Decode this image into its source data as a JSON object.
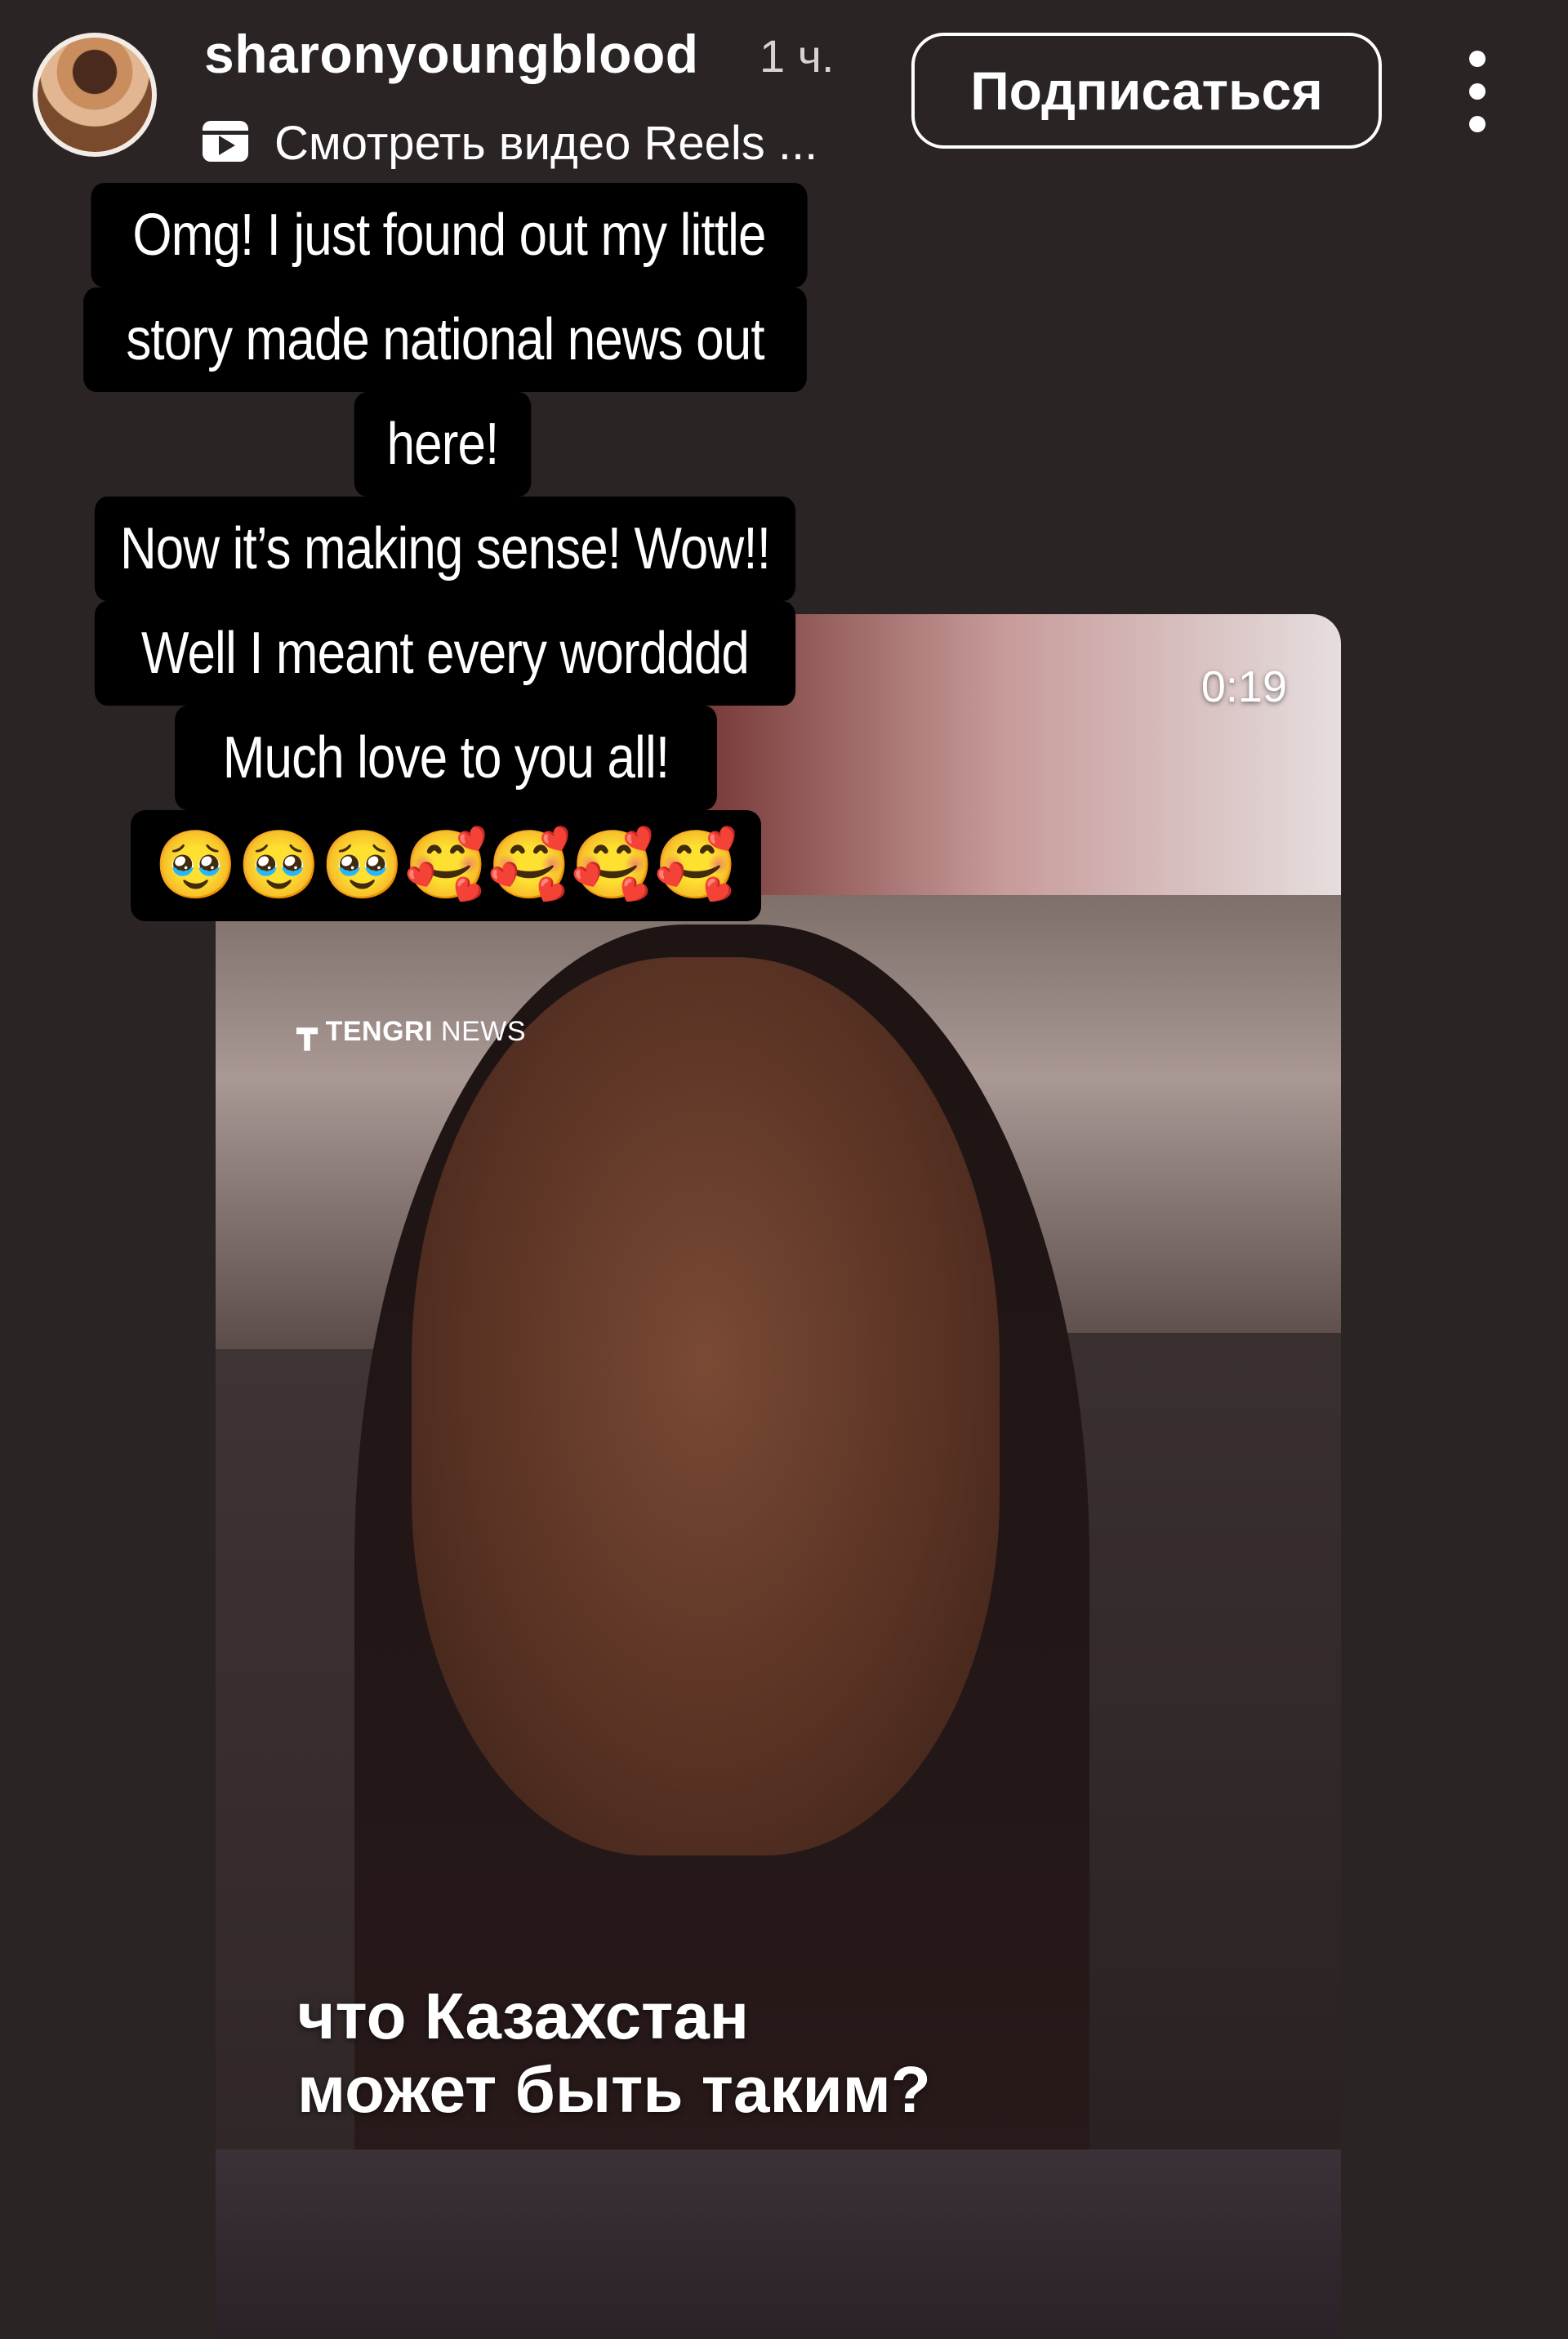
{
  "header": {
    "username": "sharonyoungblood",
    "time_ago": "1 ч.",
    "reels_link": "Смотреть видео Reels ...",
    "subscribe_label": "Подписаться",
    "more_icon": "more-vertical-icon"
  },
  "captions": {
    "line1": "Omg! I just found out my little",
    "line2": "story made national news out",
    "line3": "here!",
    "line4": "Now it’s making sense! Wow!!",
    "line5": "Well I meant every wordddd",
    "line6": "Much love to you all!",
    "emojis": "🥹🥹🥹🥰🥰🥰🥰"
  },
  "video": {
    "duration": "0:19",
    "watermark_brand": "TENGRI",
    "watermark_suffix": "NEWS",
    "subtitle_line1": "что Казахстан",
    "subtitle_line2": "может быть таким?"
  },
  "colors": {
    "background": "#2b2425",
    "caption_bg": "#000000",
    "text": "#ffffff"
  }
}
